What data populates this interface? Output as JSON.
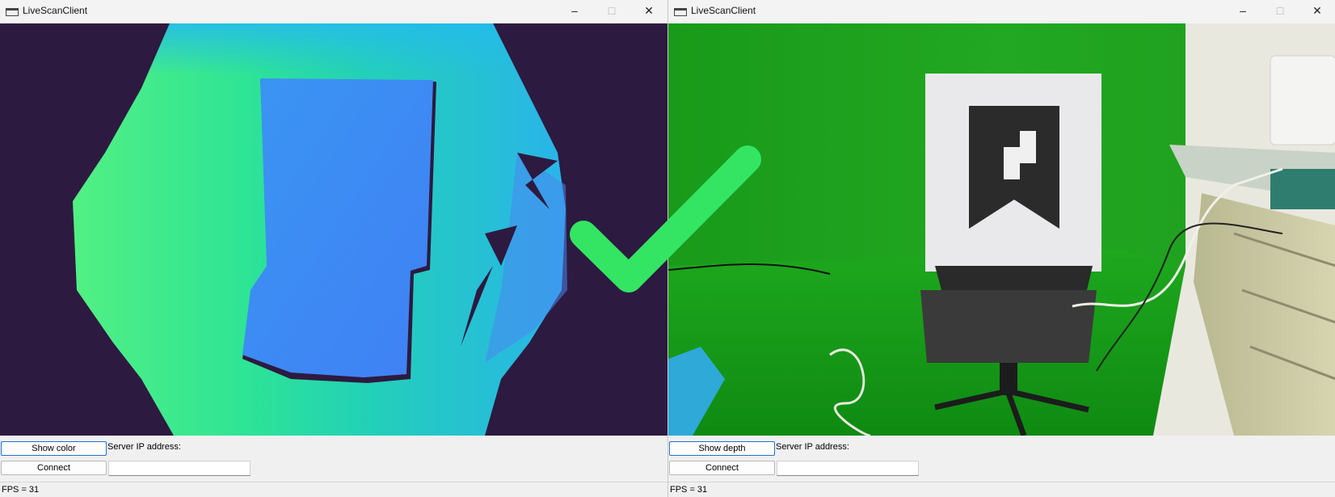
{
  "left_window": {
    "title": "LiveScanClient",
    "toggle_label": "Show color",
    "connect_label": "Connect",
    "ip_label": "Server IP address:",
    "ip_value": "",
    "status": "FPS = 31",
    "view": "depth"
  },
  "right_window": {
    "title": "LiveScanClient",
    "toggle_label": "Show depth",
    "connect_label": "Connect",
    "ip_label": "Server IP address:",
    "ip_value": "",
    "status": "FPS = 31",
    "view": "color"
  },
  "titlebar_icons": [
    "app-icon",
    "minimize-icon",
    "maximize-icon",
    "close-icon"
  ],
  "overlay_icon": "checkmark-icon",
  "colors": {
    "overlay_check": "#33e563",
    "depth_background": "#2d1a40",
    "green_screen": "#1fa51f"
  }
}
